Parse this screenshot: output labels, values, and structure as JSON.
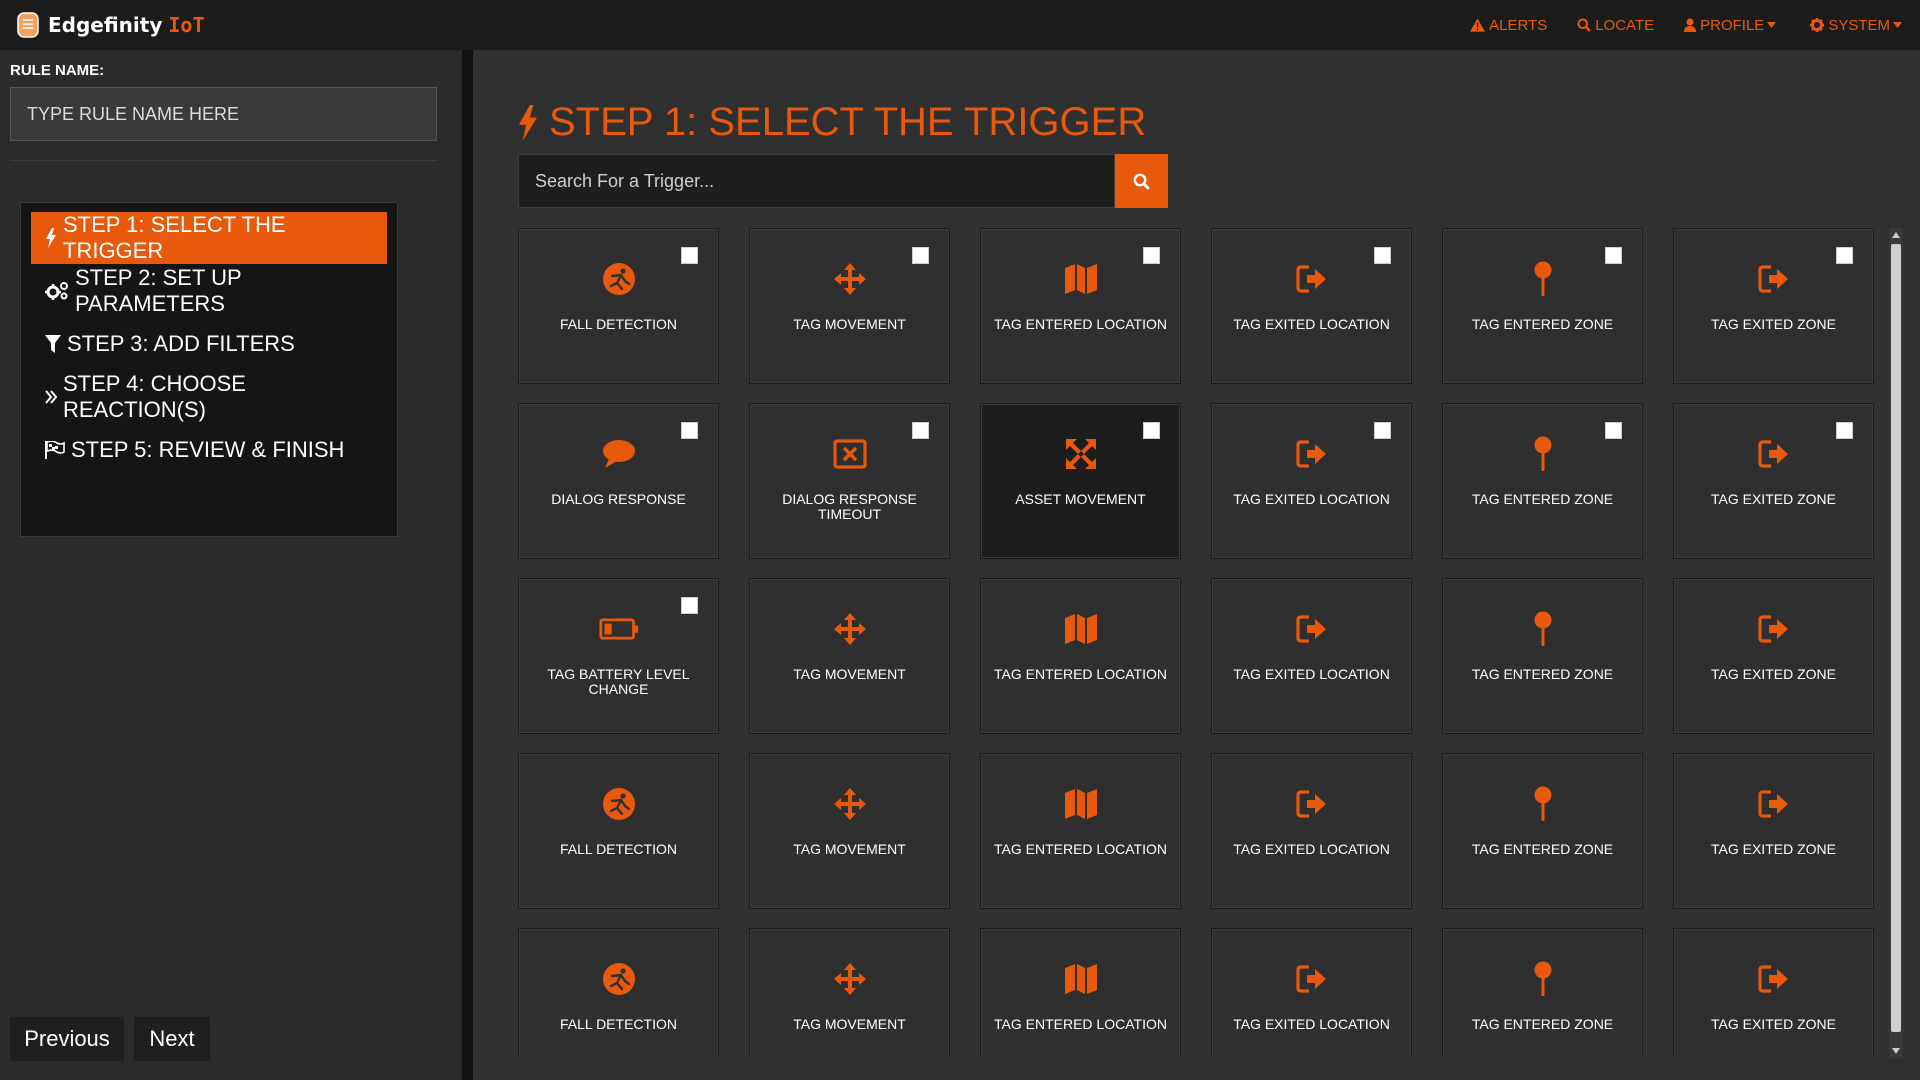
{
  "app": {
    "brand_main": "Edgefinity",
    "brand_accent": "IoT",
    "accent_color": "#e8590c"
  },
  "topnav": {
    "alerts": "ALERTS",
    "locate": "LOCATE",
    "profile": "PROFILE",
    "system": "SYSTEM"
  },
  "sidebar": {
    "rule_label": "RULE NAME:",
    "rule_placeholder": "TYPE RULE NAME HERE",
    "steps": [
      {
        "label": "STEP 1: SELECT THE TRIGGER",
        "icon": "bolt-icon",
        "active": true
      },
      {
        "label": "STEP 2: SET UP PARAMETERS",
        "icon": "gears-icon"
      },
      {
        "label": "STEP 3: ADD FILTERS",
        "icon": "filter-icon"
      },
      {
        "label": "STEP 4: CHOOSE REACTION(S)",
        "icon": "double-chevron-icon"
      },
      {
        "label": "STEP 5: REVIEW & FINISH",
        "icon": "flag-icon"
      }
    ],
    "prev_label": "Previous",
    "next_label": "Next"
  },
  "main": {
    "title": "STEP 1: SELECT THE TRIGGER",
    "search_placeholder": "Search For a Trigger..."
  },
  "triggers": [
    {
      "label": "FALL DETECTION",
      "icon": "fall",
      "checkbox": true
    },
    {
      "label": "TAG MOVEMENT",
      "icon": "move",
      "checkbox": true
    },
    {
      "label": "TAG ENTERED LOCATION",
      "icon": "map",
      "checkbox": true
    },
    {
      "label": "TAG EXITED LOCATION",
      "icon": "signout",
      "checkbox": true
    },
    {
      "label": "TAG ENTERED ZONE",
      "icon": "pin",
      "checkbox": true
    },
    {
      "label": "TAG EXITED ZONE",
      "icon": "signout",
      "checkbox": true
    },
    {
      "label": "DIALOG RESPONSE",
      "icon": "comment",
      "checkbox": true
    },
    {
      "label": "DIALOG RESPONSE TIMEOUT",
      "icon": "window-close",
      "checkbox": true
    },
    {
      "label": "ASSET MOVEMENT",
      "icon": "expand",
      "checkbox": true,
      "dark": true
    },
    {
      "label": "TAG EXITED LOCATION",
      "icon": "signout",
      "checkbox": true
    },
    {
      "label": "TAG ENTERED ZONE",
      "icon": "pin",
      "checkbox": true
    },
    {
      "label": "TAG EXITED ZONE",
      "icon": "signout",
      "checkbox": true
    },
    {
      "label": "TAG BATTERY LEVEL CHANGE",
      "icon": "battery",
      "checkbox": true
    },
    {
      "label": "TAG MOVEMENT",
      "icon": "move"
    },
    {
      "label": "TAG ENTERED LOCATION",
      "icon": "map"
    },
    {
      "label": "TAG EXITED LOCATION",
      "icon": "signout"
    },
    {
      "label": "TAG ENTERED ZONE",
      "icon": "pin"
    },
    {
      "label": "TAG EXITED ZONE",
      "icon": "signout"
    },
    {
      "label": "FALL DETECTION",
      "icon": "fall"
    },
    {
      "label": "TAG MOVEMENT",
      "icon": "move"
    },
    {
      "label": "TAG ENTERED LOCATION",
      "icon": "map"
    },
    {
      "label": "TAG EXITED LOCATION",
      "icon": "signout"
    },
    {
      "label": "TAG ENTERED ZONE",
      "icon": "pin"
    },
    {
      "label": "TAG EXITED ZONE",
      "icon": "signout"
    },
    {
      "label": "FALL DETECTION",
      "icon": "fall"
    },
    {
      "label": "TAG MOVEMENT",
      "icon": "move"
    },
    {
      "label": "TAG ENTERED LOCATION",
      "icon": "map"
    },
    {
      "label": "TAG EXITED LOCATION",
      "icon": "signout"
    },
    {
      "label": "TAG ENTERED ZONE",
      "icon": "pin"
    },
    {
      "label": "TAG EXITED ZONE",
      "icon": "signout"
    }
  ]
}
